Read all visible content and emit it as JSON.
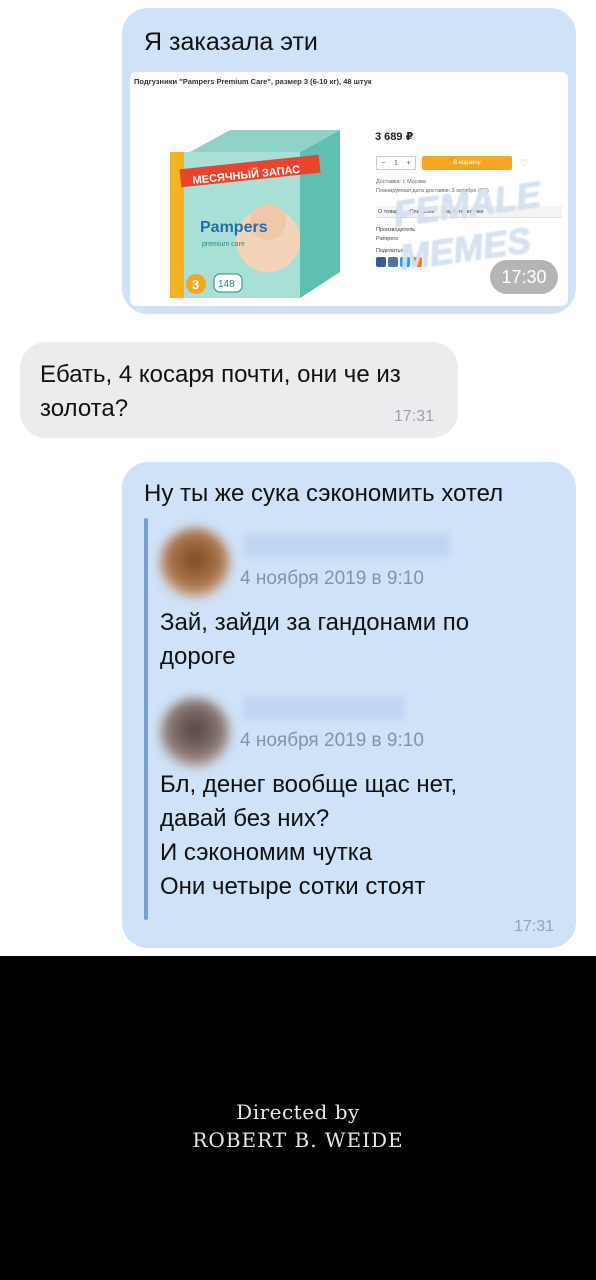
{
  "messages": [
    {
      "direction": "outgoing",
      "text": "Я заказала эти",
      "time": "17:30",
      "product": {
        "title": "Подгузники \"Pampers Premium Care\", размер 3 (6-10 кг), 48 штук",
        "price": "3 689 ₽",
        "qty": "1",
        "buy_label": "В корзину",
        "delivery_lines": [
          "Доставка: г. Москва",
          "Планируемая дата доставки: 3 октября (Сб)"
        ],
        "tabs": [
          "О товаре",
          "Описание",
          "Характеристики"
        ],
        "manufacturer_label": "Производитель",
        "manufacturer": "Pampers",
        "share_label": "Поделиться:",
        "box_banner": "МЕСЯЧНЫЙ ЗАПАС",
        "brand": "Pampers",
        "brand_sub": "premium care",
        "size_badge": "3",
        "count_badge": "148",
        "watermark": "FEMALE MEMES"
      }
    },
    {
      "direction": "incoming",
      "text": "Ебать, 4 косаря почти, они че из золота?",
      "time": "17:31"
    },
    {
      "direction": "outgoing",
      "text": "Ну ты же сука сэкономить хотел",
      "time": "17:31",
      "quoted": [
        {
          "date": "4 ноября 2019 в 9:10",
          "text": "Зай, зайди за гандонами по дороге"
        },
        {
          "date": "4 ноября 2019 в 9:10",
          "text": "Бл, денег вообще щас нет, давай без них?\nИ сэкономим чутка\nОни четыре сотки стоят"
        }
      ]
    }
  ],
  "credits": {
    "line1": "Directed by",
    "line2": "ROBERT B. WEIDE"
  },
  "colors": {
    "outgoing_bubble": "#cfe2f8",
    "incoming_bubble": "#ececee",
    "quote_bar": "#7a9fcf",
    "buy_button": "#f5a623"
  }
}
